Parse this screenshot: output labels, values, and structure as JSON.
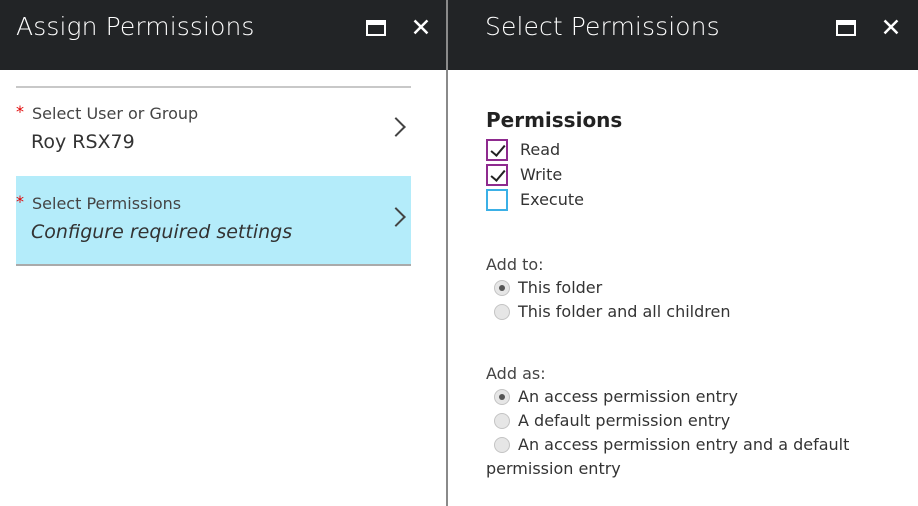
{
  "left_blade": {
    "title": "Assign Permissions",
    "items": [
      {
        "label": "Select User or Group",
        "value": "Roy RSX79"
      },
      {
        "label": "Select Permissions",
        "value": "Configure required settings"
      }
    ]
  },
  "right_blade": {
    "title": "Select Permissions",
    "permissions_heading": "Permissions",
    "checkboxes": [
      {
        "label": "Read",
        "checked": true
      },
      {
        "label": "Write",
        "checked": true
      },
      {
        "label": "Execute",
        "checked": false
      }
    ],
    "add_to": {
      "label": "Add to:",
      "options": [
        "This folder",
        "This folder and all children"
      ],
      "selected": "This folder"
    },
    "add_as": {
      "label": "Add as:",
      "options": [
        "An access permission entry",
        "A default permission entry",
        "An access permission entry and a default"
      ],
      "option3_wrap": "permission entry",
      "selected": "An access permission entry"
    }
  },
  "required_marker": "*",
  "colors": {
    "header": "#222426",
    "active_item": "#b4ecfa",
    "required": "#e00000",
    "checkbox_checked": "#8e2a8e",
    "checkbox_unchecked": "#3bb0e6"
  },
  "icons": [
    "maximize-icon",
    "close-icon",
    "chevron-right-icon",
    "checkmark-icon"
  ]
}
